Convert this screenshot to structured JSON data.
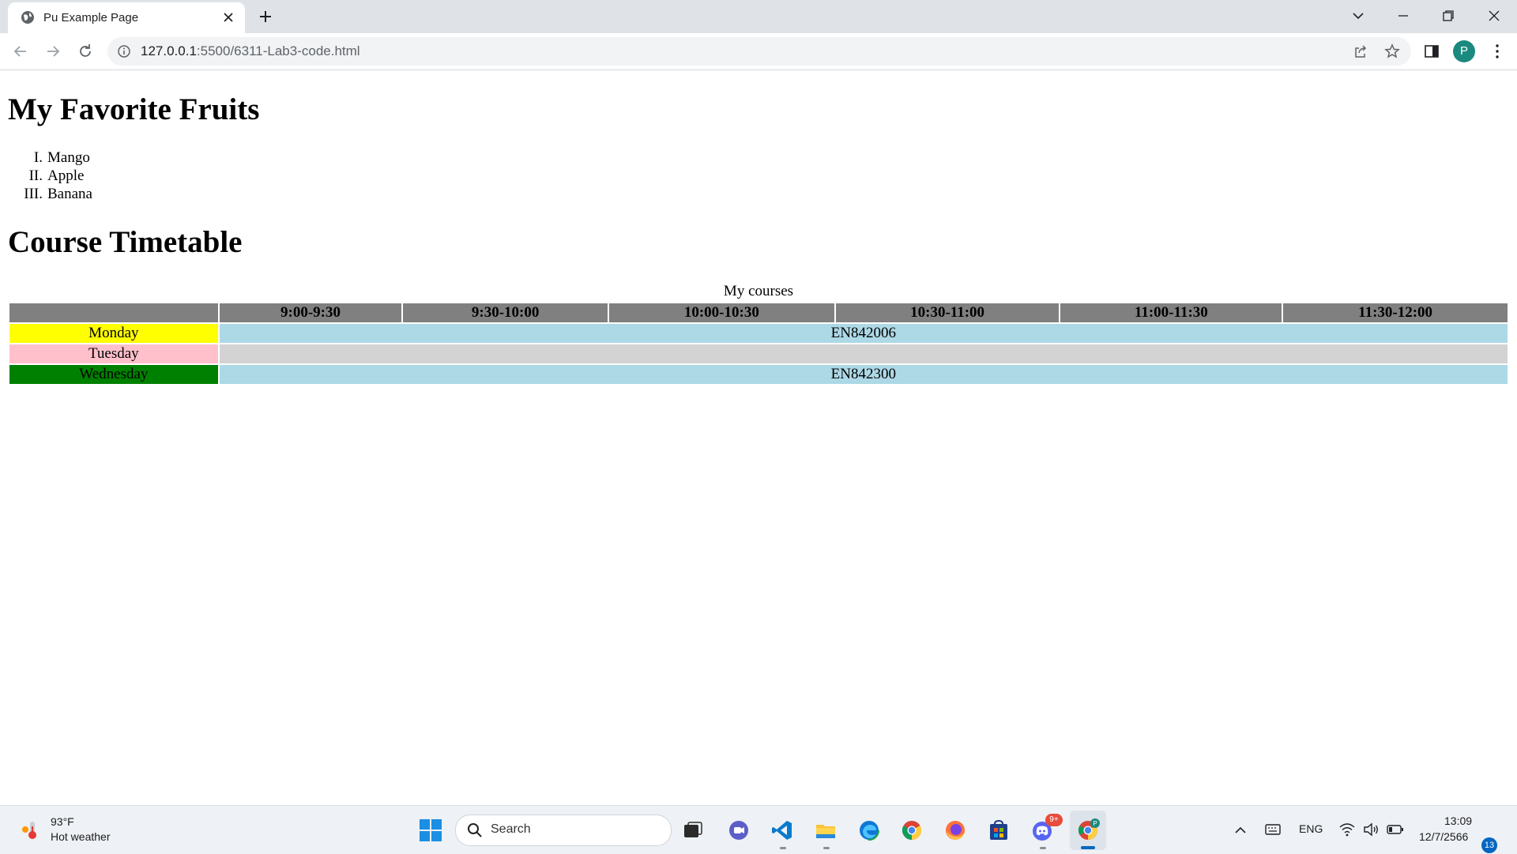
{
  "browser": {
    "tab_title": "Pu Example Page",
    "url_host": "127.0.0.1",
    "url_rest": ":5500/6311-Lab3-code.html",
    "profile_initial": "P"
  },
  "page": {
    "heading_fruits": "My Favorite Fruits",
    "fruits": [
      {
        "num": "I.",
        "name": "Mango"
      },
      {
        "num": "II.",
        "name": "Apple"
      },
      {
        "num": "III.",
        "name": "Banana"
      }
    ],
    "heading_timetable": "Course Timetable",
    "timetable": {
      "caption": "My courses",
      "time_slots": [
        "9:00-9:30",
        "9:30-10:00",
        "10:00-10:30",
        "10:30-11:00",
        "11:00-11:30",
        "11:30-12:00"
      ],
      "rows": [
        {
          "day": "Monday",
          "course": "EN842006",
          "day_color": "#ffff00",
          "cell_color": "#add8e6"
        },
        {
          "day": "Tuesday",
          "course": "",
          "day_color": "#ffc0cb",
          "cell_color": "#d3d3d3"
        },
        {
          "day": "Wednesday",
          "course": "EN842300",
          "day_color": "#008000",
          "cell_color": "#add8e6"
        }
      ],
      "header_color": "#808080"
    }
  },
  "taskbar": {
    "weather_temp": "93°F",
    "weather_desc": "Hot weather",
    "search_label": "Search",
    "lang": "ENG",
    "time": "13:09",
    "date": "12/7/2566",
    "notification_count": "13",
    "discord_badge": "9+"
  }
}
